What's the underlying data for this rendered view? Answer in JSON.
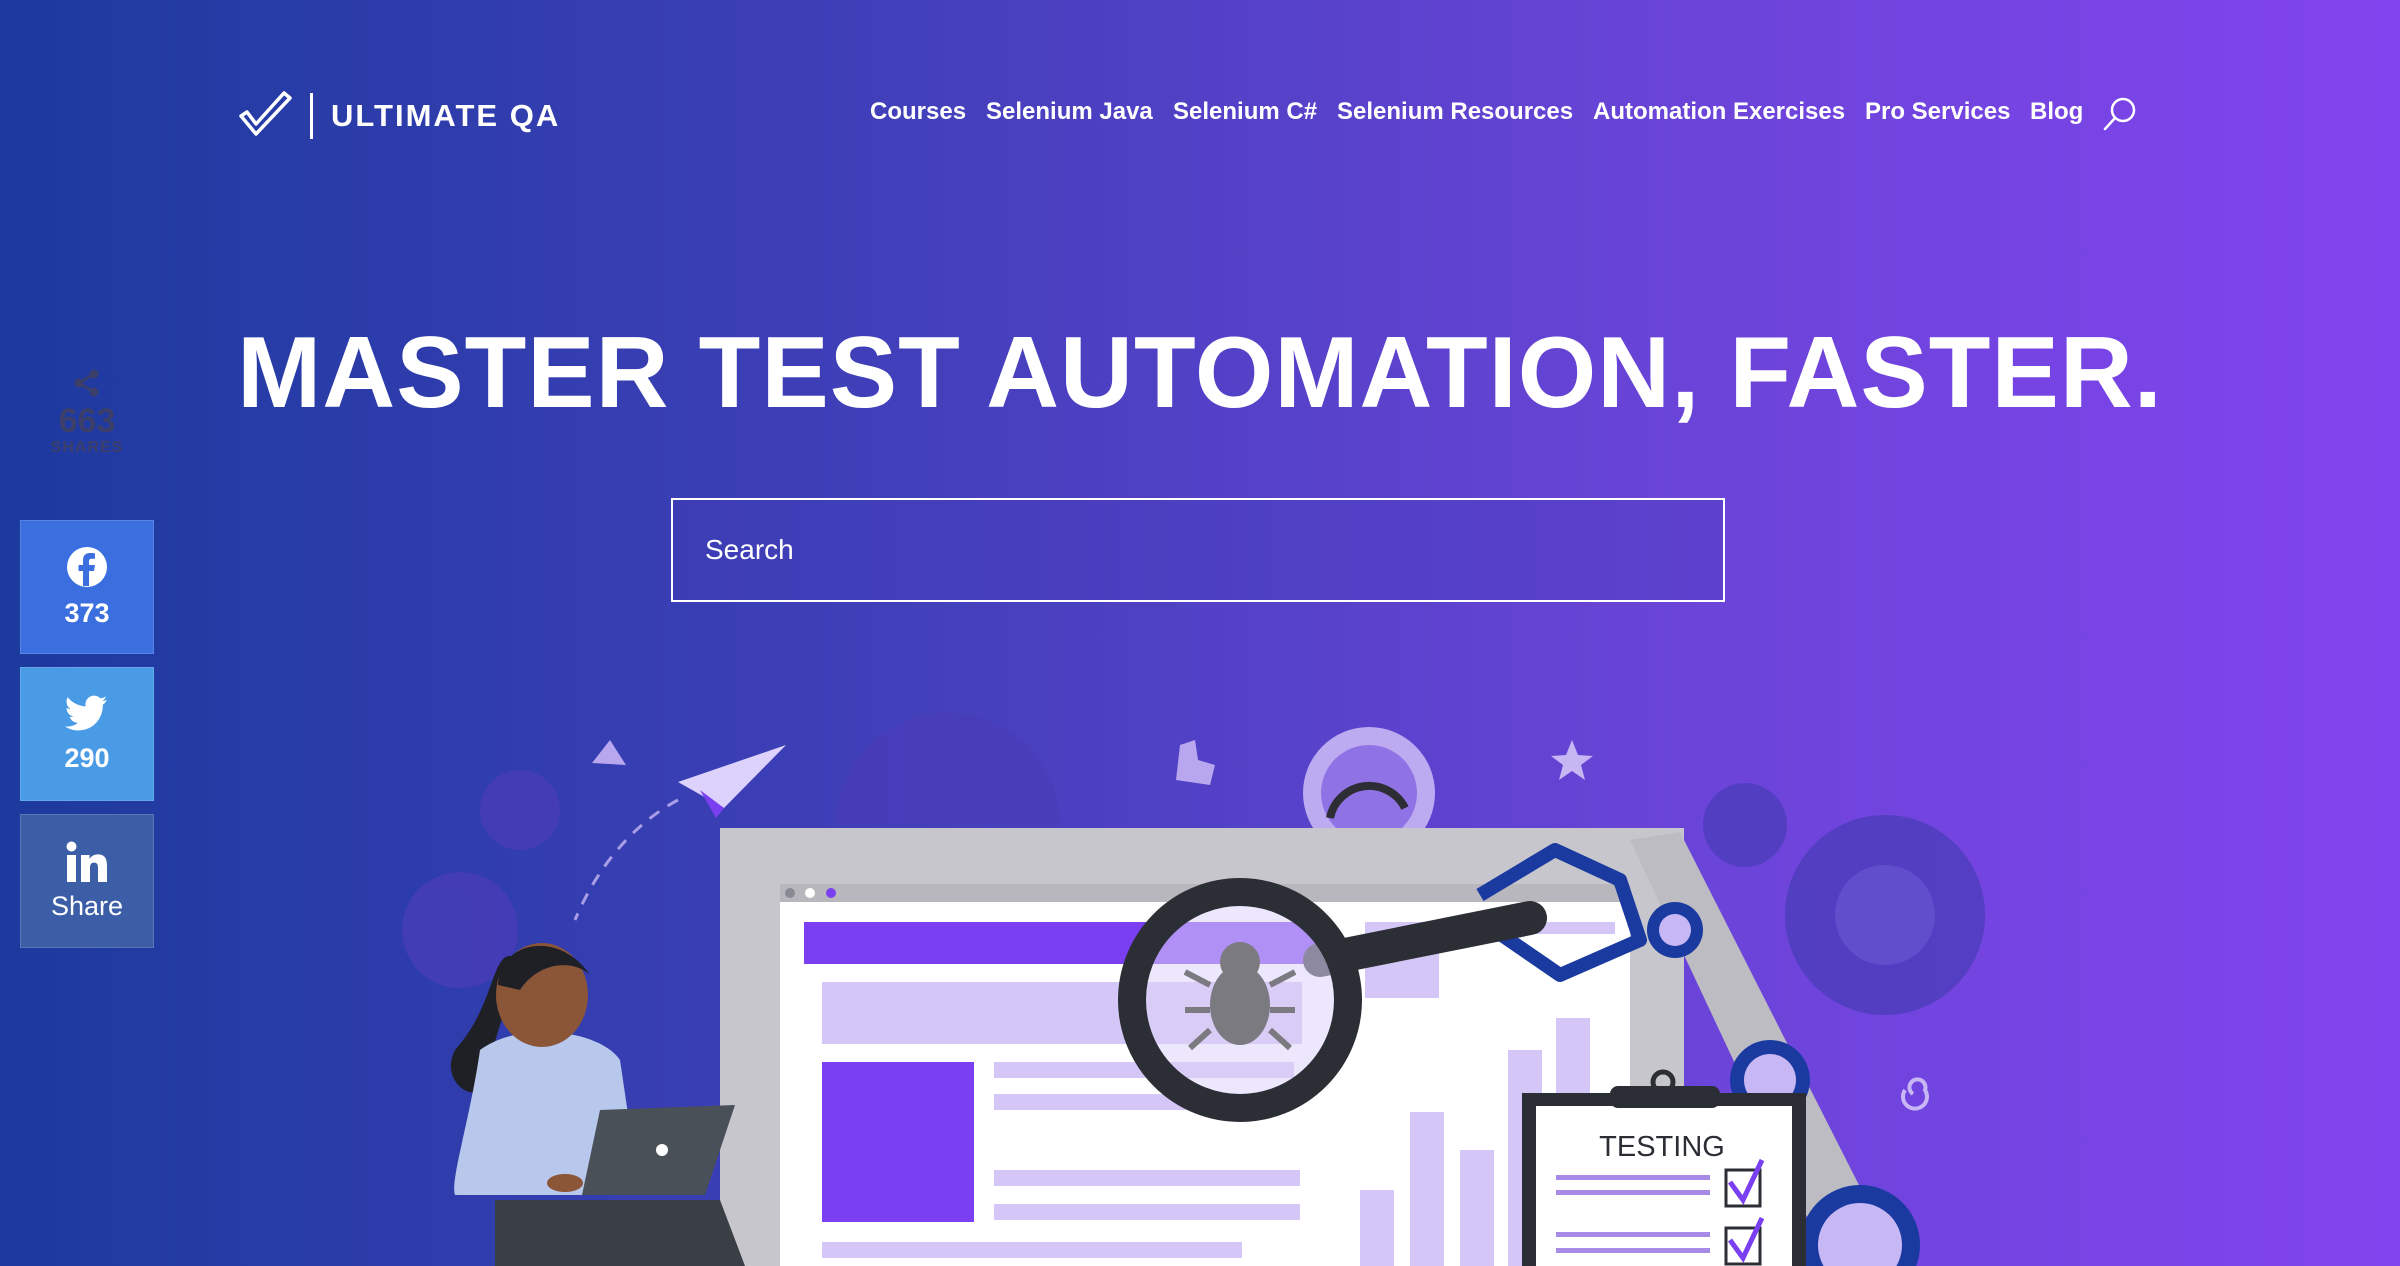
{
  "brand": {
    "name": "ULTIMATE QA"
  },
  "nav": {
    "items": [
      {
        "label": "Courses"
      },
      {
        "label": "Selenium Java"
      },
      {
        "label": "Selenium C#"
      },
      {
        "label": "Selenium Resources"
      },
      {
        "label": "Automation Exercises"
      },
      {
        "label": "Pro Services"
      },
      {
        "label": "Blog"
      }
    ],
    "search_icon": "search-icon"
  },
  "hero": {
    "title": "MASTER TEST AUTOMATION, FASTER.",
    "search_placeholder": "Search"
  },
  "share": {
    "total": "663",
    "total_label": "SHARES",
    "facebook": {
      "count": "373",
      "icon": "facebook-icon",
      "color": "#3b6fe0"
    },
    "twitter": {
      "count": "290",
      "icon": "twitter-icon",
      "color": "#4a9be6"
    },
    "linkedin": {
      "label": "Share",
      "icon": "linkedin-icon",
      "color": "#3b5ea6"
    }
  },
  "illustration": {
    "clipboard_label": "TESTING"
  },
  "colors": {
    "accent": "#7a3ff0",
    "gradient_start": "#1c3a9e",
    "gradient_end": "#8244ee"
  }
}
